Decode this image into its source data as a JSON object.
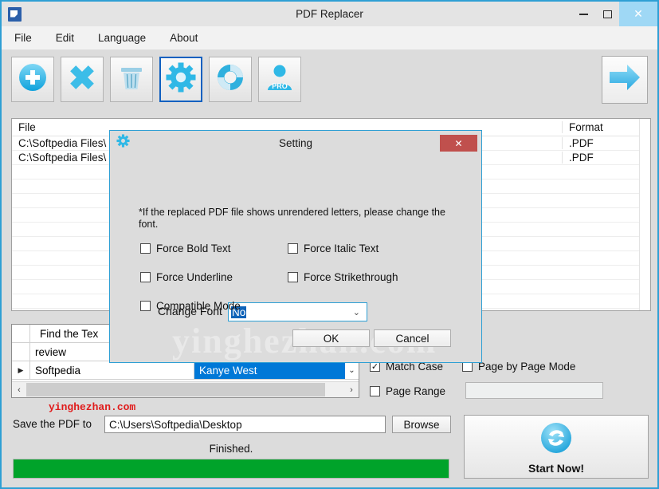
{
  "window": {
    "title": "PDF Replacer",
    "app_icon": "pdf-document-icon",
    "controls": {
      "minimize": "minimize-icon",
      "maximize": "maximize-icon",
      "close": "✕"
    }
  },
  "menubar": {
    "items": [
      "File",
      "Edit",
      "Language",
      "About"
    ]
  },
  "toolbar": {
    "buttons": [
      {
        "name": "add-files-button",
        "icon": "plus-circle-icon",
        "selected": false
      },
      {
        "name": "remove-file-button",
        "icon": "cross-icon",
        "selected": false
      },
      {
        "name": "clear-list-button",
        "icon": "trash-icon",
        "selected": false
      },
      {
        "name": "settings-button",
        "icon": "gear-icon",
        "selected": true
      },
      {
        "name": "help-button",
        "icon": "lifebuoy-icon",
        "selected": false
      },
      {
        "name": "pro-button",
        "icon": "user-pro-icon",
        "selected": false,
        "label": "PRO"
      }
    ],
    "convert_button": {
      "name": "convert-arrow-button",
      "icon": "arrow-right-icon"
    }
  },
  "file_list": {
    "columns": [
      "File",
      "Format"
    ],
    "rows": [
      {
        "file": "C:\\Softpedia Files\\",
        "format": ".PDF"
      },
      {
        "file": "C:\\Softpedia Files\\",
        "format": ".PDF"
      }
    ],
    "empty_row_count": 11
  },
  "replace_grid": {
    "columns": [
      "",
      "Find the Tex",
      ""
    ],
    "rows": [
      {
        "marker": "",
        "find": "review",
        "replace": "",
        "selected": false
      },
      {
        "marker": "▶",
        "find": "Softpedia",
        "replace": "Kanye West",
        "selected": true
      }
    ],
    "scroll_left_icon": "‹",
    "scroll_right_icon": "›",
    "dropdown_icon": "⌄"
  },
  "options": {
    "match_case": {
      "label": "Match Case",
      "checked": true,
      "mark": "✓"
    },
    "page_by_page": {
      "label": "Page by Page Mode",
      "checked": false,
      "mark": ""
    },
    "page_range": {
      "label": "Page Range",
      "checked": false,
      "mark": ""
    },
    "page_range_value": ""
  },
  "save": {
    "label": "Save the PDF to",
    "path": "C:\\Users\\Softpedia\\Desktop",
    "browse_label": "Browse"
  },
  "watermark": {
    "top": "yinghezhan.com",
    "dialog": "yinghezhan.com"
  },
  "status": {
    "text": "Finished.",
    "progress_percent": 100
  },
  "start_now": {
    "label": "Start Now!",
    "icon": "refresh-circle-icon"
  },
  "dialog": {
    "title": "Setting",
    "icon": "gear-icon",
    "close_label": "✕",
    "change_font_label": "Change Font",
    "change_font_value": "No",
    "dropdown_icon": "⌄",
    "note": "*If the replaced PDF file shows unrendered letters, please change the font.",
    "checkboxes": [
      {
        "name": "force-bold-text",
        "label": "Force Bold Text",
        "checked": false
      },
      {
        "name": "force-italic-text",
        "label": "Force Italic Text",
        "checked": false
      },
      {
        "name": "force-underline",
        "label": "Force Underline",
        "checked": false
      },
      {
        "name": "force-strikethrough",
        "label": "Force Strikethrough",
        "checked": false
      },
      {
        "name": "compatible-mode",
        "label": "Compatible Mode",
        "checked": false
      }
    ],
    "ok_label": "OK",
    "cancel_label": "Cancel"
  },
  "colors": {
    "window_border": "#2e9fd4",
    "accent_blue": "#29abe2",
    "selection_blue": "#0078d7",
    "progress_green": "#00a32a",
    "dialog_close_red": "#c0504d",
    "watermark_red": "#e01b1b"
  }
}
